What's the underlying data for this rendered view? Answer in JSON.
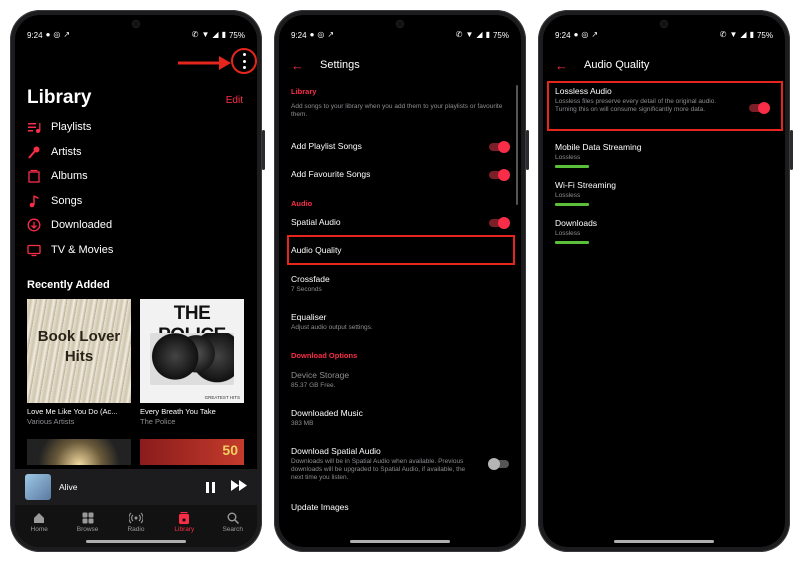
{
  "status": {
    "time": "9:24",
    "battery": "75%"
  },
  "library": {
    "title": "Library",
    "edit": "Edit",
    "items": [
      {
        "label": "Playlists",
        "icon": "playlists-icon"
      },
      {
        "label": "Artists",
        "icon": "artists-icon"
      },
      {
        "label": "Albums",
        "icon": "albums-icon"
      },
      {
        "label": "Songs",
        "icon": "songs-icon"
      },
      {
        "label": "Downloaded",
        "icon": "downloaded-icon"
      },
      {
        "label": "TV & Movies",
        "icon": "tv-icon"
      }
    ],
    "recent_title": "Recently Added",
    "albums": [
      {
        "art_text": "Book Lover Hits",
        "title": "Love Me Like You Do (Ac...",
        "artist": "Various Artists"
      },
      {
        "art_text": "THE POLICE",
        "art_sub": "GREATEST HITS",
        "title": "Every Breath You Take",
        "artist": "The Police"
      }
    ],
    "thumb_text": "50"
  },
  "miniplayer": {
    "title": "Alive"
  },
  "tabs": [
    {
      "label": "Home",
      "icon": "home-icon"
    },
    {
      "label": "Browse",
      "icon": "browse-icon"
    },
    {
      "label": "Radio",
      "icon": "radio-icon"
    },
    {
      "label": "Library",
      "icon": "library-icon",
      "active": true
    },
    {
      "label": "Search",
      "icon": "search-icon"
    }
  ],
  "settings": {
    "title": "Settings",
    "library_header": "Library",
    "library_desc": "Add songs to your library when you add them to your playlists or favourite them.",
    "add_playlist_songs": "Add Playlist Songs",
    "add_favourite_songs": "Add Favourite Songs",
    "audio_header": "Audio",
    "spatial_audio": "Spatial Audio",
    "audio_quality": "Audio Quality",
    "crossfade": "Crossfade",
    "crossfade_value": "7 Seconds",
    "equaliser": "Equaliser",
    "equaliser_desc": "Adjust audio output settings.",
    "download_header": "Download Options",
    "device_storage": "Device Storage",
    "device_storage_value": "85.37 GB Free.",
    "downloaded_music": "Downloaded Music",
    "downloaded_music_value": "383 MB",
    "download_spatial": "Download Spatial Audio",
    "download_spatial_desc": "Downloads will be in Spatial Audio when available. Previous downloads will be upgraded to Spatial Audio, if available, the next time you listen.",
    "update_images": "Update Images"
  },
  "audio_quality": {
    "title": "Audio Quality",
    "lossless": "Lossless Audio",
    "lossless_desc": "Lossless files preserve every detail of the original audio. Turning this on will consume significantly more data.",
    "mobile": "Mobile Data Streaming",
    "mobile_value": "Lossless",
    "wifi": "Wi-Fi Streaming",
    "wifi_value": "Lossless",
    "downloads": "Downloads",
    "downloads_value": "Lossless"
  },
  "colors": {
    "accent": "#fa2d48",
    "highlight": "#e6261c",
    "quality_bar": "#5bbf3a"
  }
}
